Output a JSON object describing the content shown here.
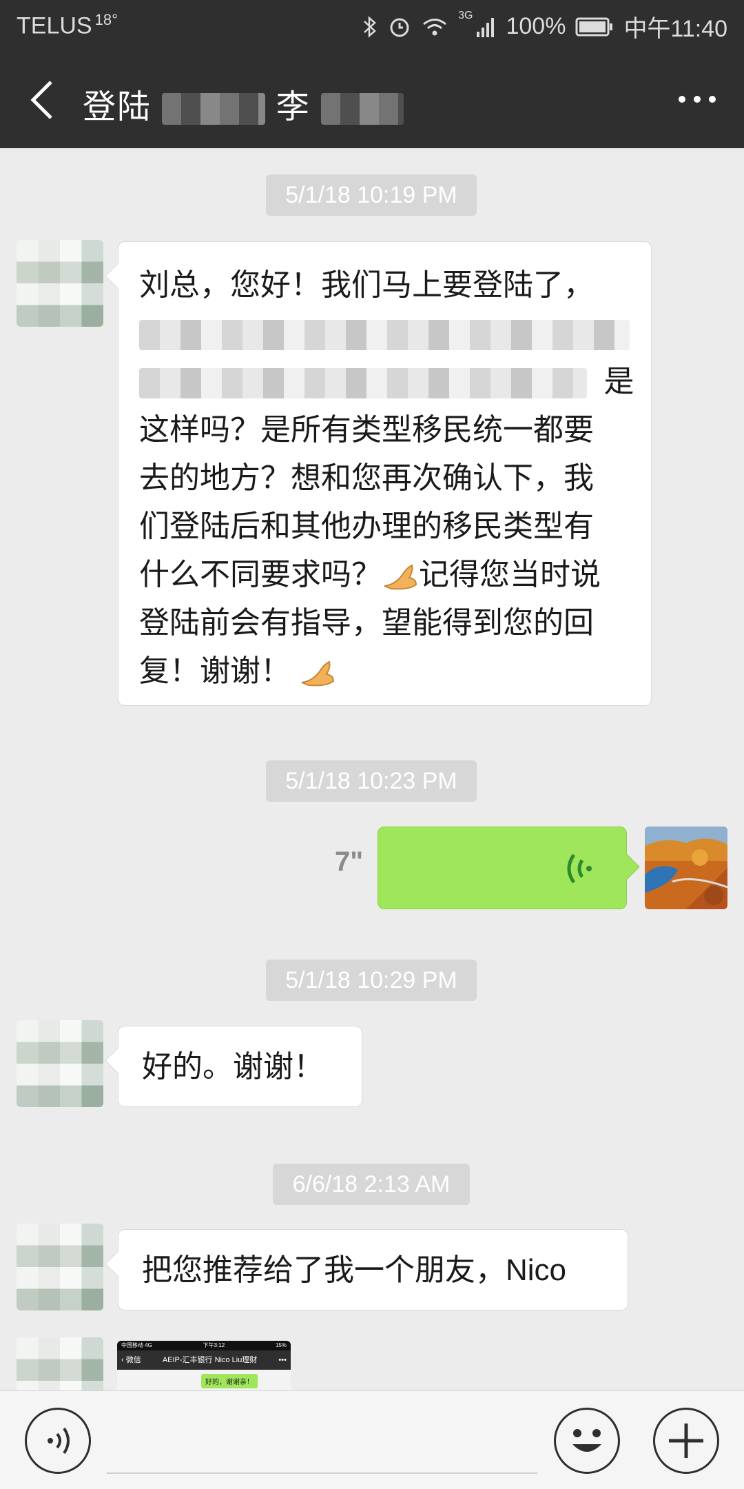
{
  "status_bar": {
    "carrier": "TELUS",
    "temperature": "18°",
    "network": "3G",
    "battery": "100%",
    "time": "中午11:40"
  },
  "header": {
    "title_prefix": "登陆",
    "title_middle": "李",
    "back_icon": "chevron-left-icon",
    "menu_icon": "more-icon"
  },
  "messages": [
    {
      "timestamp": "5/1/18 10:19 PM"
    },
    {
      "sender": "other",
      "lines": [
        "刘总，您好！我们马上要登陆了，",
        "",
        "是",
        "这样吗？是所有类型移民统一都要",
        "去的地方？想和您再次确认下，我",
        "们登陆后和其他办理的移民类型有",
        "什么不同要求吗？",
        "记得您当时说",
        "登陆前会有指导，望能得到您的回",
        "复！谢谢！"
      ]
    },
    {
      "timestamp": "5/1/18 10:23 PM"
    },
    {
      "sender": "me",
      "type": "voice",
      "duration": "7\""
    },
    {
      "timestamp": "5/1/18 10:29 PM"
    },
    {
      "sender": "other",
      "text": "好的。谢谢！"
    },
    {
      "timestamp": "6/6/18 2:13 AM"
    },
    {
      "sender": "other",
      "text": "把您推荐给了我一个朋友，Nico"
    },
    {
      "sender": "other",
      "type": "image",
      "thumb": {
        "carrier": "中国移动 4G",
        "time": "下午3:12",
        "battery": "15%",
        "back": "微信",
        "title": "AEIP-汇丰银行 Nico Liu理财",
        "message": "好的，谢谢亲！"
      }
    }
  ],
  "input_bar": {
    "voice_icon": "voice-input-icon",
    "emoji_icon": "emoji-icon",
    "add_icon": "plus-icon"
  },
  "colors": {
    "header_bg": "#2f2f2f",
    "chat_bg": "#ececec",
    "my_bubble": "#9fe65a",
    "timestamp_bg": "#d7d7d7"
  }
}
